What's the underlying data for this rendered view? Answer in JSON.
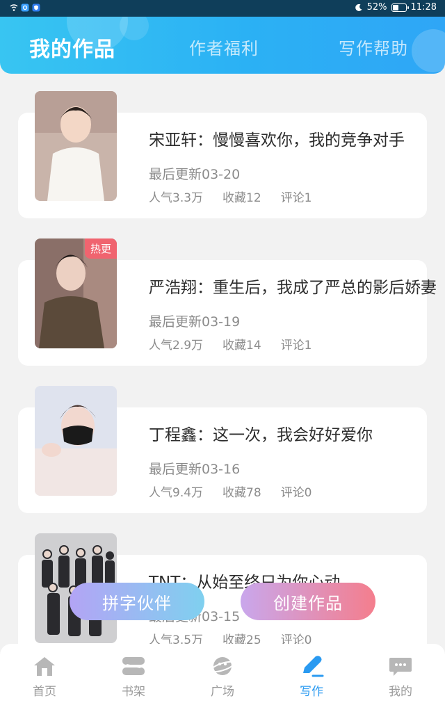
{
  "status_bar": {
    "battery": "52%",
    "time": "11:28"
  },
  "header": {
    "tabs": [
      {
        "label": "我的作品",
        "active": true
      },
      {
        "label": "作者福利",
        "active": false
      },
      {
        "label": "写作帮助",
        "active": false
      }
    ]
  },
  "works": [
    {
      "title": "宋亚轩：慢慢喜欢你，我的竞争对手",
      "updated": "最后更新03-20",
      "popularity": "人气3.3万",
      "favorites": "收藏12",
      "comments": "评论1",
      "badge": ""
    },
    {
      "title": "严浩翔：重生后，我成了严总的影后娇妻",
      "updated": "最后更新03-19",
      "popularity": "人气2.9万",
      "favorites": "收藏14",
      "comments": "评论1",
      "badge": "热更"
    },
    {
      "title": "丁程鑫：这一次，我会好好爱你",
      "updated": "最后更新03-16",
      "popularity": "人气9.4万",
      "favorites": "收藏78",
      "comments": "评论0",
      "badge": ""
    },
    {
      "title": "TNT：从始至终只为你心动",
      "updated": "最后更新03-15",
      "popularity": "人气3.5万",
      "favorites": "收藏25",
      "comments": "评论0",
      "badge": ""
    }
  ],
  "actions": {
    "partner": "拼字伙伴",
    "create": "创建作品"
  },
  "bottom_nav": [
    {
      "label": "首页",
      "icon": "home-icon",
      "active": false
    },
    {
      "label": "书架",
      "icon": "bookshelf-icon",
      "active": false
    },
    {
      "label": "广场",
      "icon": "planet-icon",
      "active": false
    },
    {
      "label": "写作",
      "icon": "pen-icon",
      "active": true
    },
    {
      "label": "我的",
      "icon": "chat-bubble-icon",
      "active": false
    }
  ],
  "colors": {
    "header_gradient_start": "#38c5f2",
    "header_gradient_end": "#2fa6f6",
    "active_nav": "#2a9af1",
    "hot_badge": "#f0646f"
  }
}
